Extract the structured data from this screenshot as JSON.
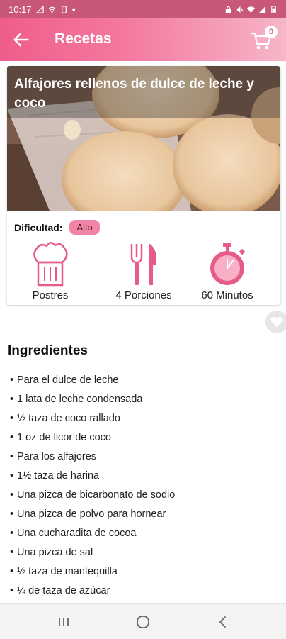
{
  "status_bar": {
    "time": "10:17",
    "icons": [
      "signal-icon",
      "wifi-calling-icon",
      "mute-icon",
      "wifi-icon",
      "signal-bars-icon",
      "battery-icon"
    ]
  },
  "app_bar": {
    "title": "Recetas",
    "cart_count": "0"
  },
  "recipe": {
    "title": "Alfajores rellenos de dulce de leche y coco",
    "difficulty_label": "Dificultad:",
    "difficulty_value": "Alta",
    "category": "Postres",
    "servings": "4 Porciones",
    "time": "60 Minutos"
  },
  "ingredients": {
    "heading": "Ingredientes",
    "items": [
      "Para el dulce de leche",
      "1 lata de leche condensada",
      "½ taza de coco rallado",
      "1 oz de licor de coco",
      "Para los alfajores",
      "1½ taza de harina",
      "Una pizca de bicarbonato de sodio",
      "Una pizca de polvo para hornear",
      "Una cucharadita de cocoa",
      "Una pizca de sal",
      "½ taza de mantequilla",
      "¼ de taza de azúcar"
    ]
  },
  "colors": {
    "accent": "#ef5d8b",
    "status_bar": "#c8577a",
    "badge": "#f085a6"
  }
}
